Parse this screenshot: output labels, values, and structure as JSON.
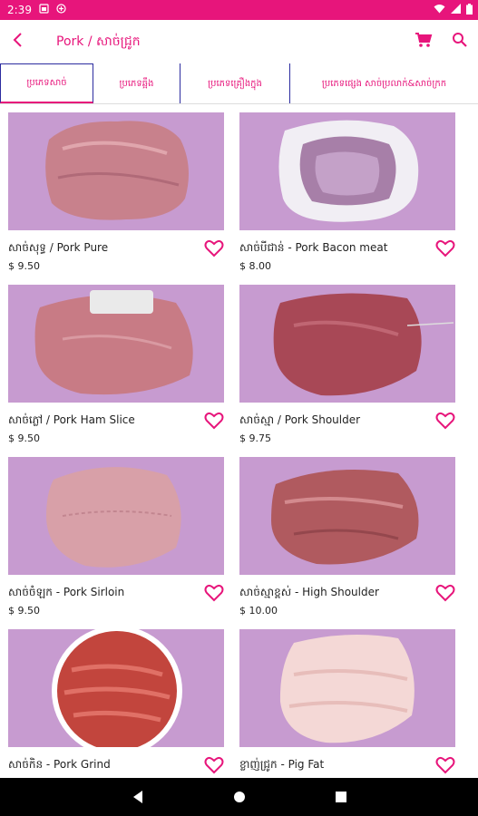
{
  "status_bar": {
    "time": "2:39"
  },
  "header": {
    "title": "Pork / សាច់ជ្រូក"
  },
  "tabs": [
    {
      "label": "ប្រភេទសាច់"
    },
    {
      "label": "ប្រភេទឆ្អឹង"
    },
    {
      "label": "ប្រភេទគ្រឿងក្នុង"
    },
    {
      "label": "ប្រភេទផ្សេង  សាច់ប្រលាក់&សាច់ក្រក"
    }
  ],
  "products": [
    {
      "name": "សាច់សុទ្ធ / Pork Pure",
      "price": "$ 9.50"
    },
    {
      "name": "សាច់បីជាន់ - Pork Bacon meat",
      "price": "$ 8.00"
    },
    {
      "name": "សាច់ភ្លៅ / Pork Ham Slice",
      "price": "$ 9.50"
    },
    {
      "name": "សាច់ស្មា / Pork Shoulder",
      "price": "$ 9.75"
    },
    {
      "name": "សាច់ចំឡក - Pork Sirloin",
      "price": "$ 9.50"
    },
    {
      "name": "សាច់ស្មាខ្ពស់ - High Shoulder",
      "price": "$ 10.00"
    },
    {
      "name": "សាច់កិន - Pork Grind",
      "price": ""
    },
    {
      "name": "ខ្លាញ់ជ្រូក - Pig Fat",
      "price": ""
    }
  ],
  "colors": {
    "accent": "#e7157b",
    "image_bg": "#c79bd0",
    "tab_border": "#2c2ca0"
  },
  "icons": {
    "back": "chevron-left-icon",
    "cart": "cart-icon",
    "search": "search-icon",
    "favorite": "heart-outline-icon"
  }
}
